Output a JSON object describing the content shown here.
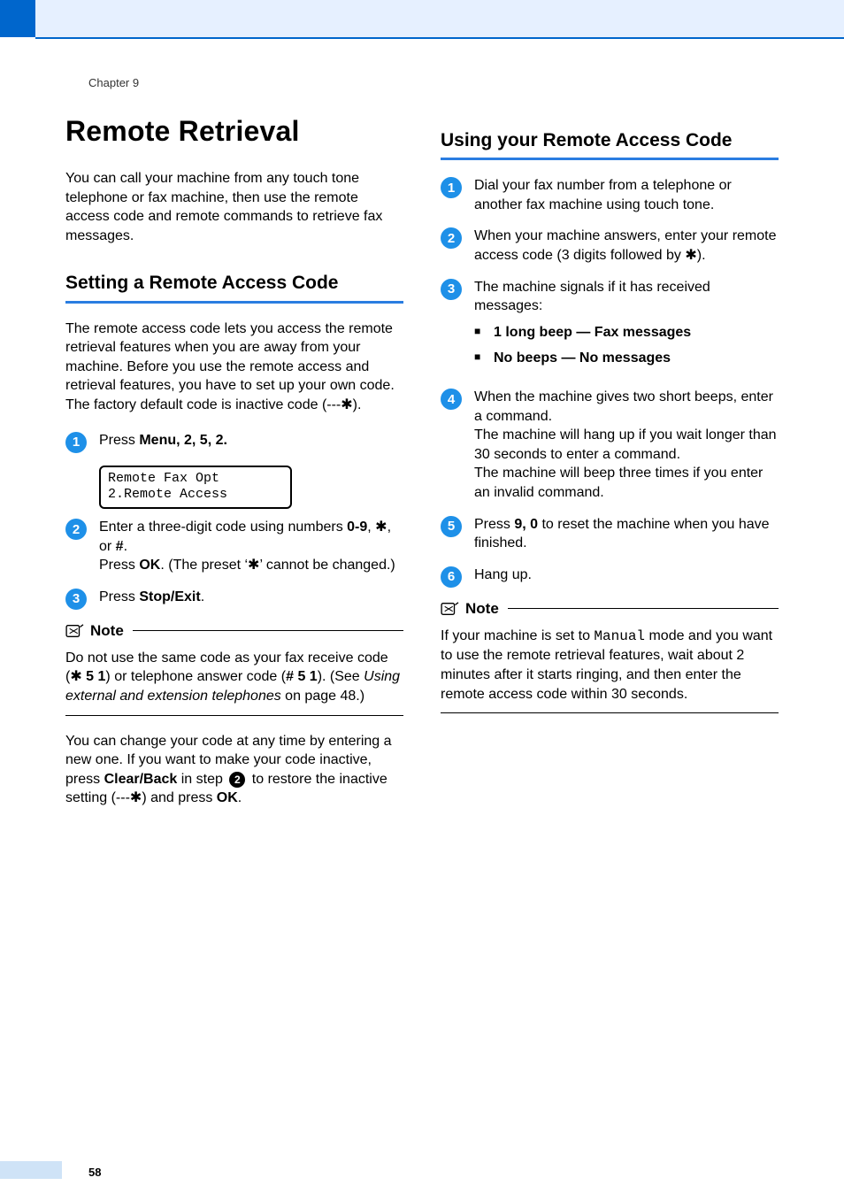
{
  "header": {
    "chapter": "Chapter 9"
  },
  "left": {
    "title": "Remote Retrieval",
    "intro": "You can call your machine from any touch tone telephone or fax machine, then use the remote access code and remote commands to retrieve fax messages.",
    "sec1_head": "Setting a Remote Access Code",
    "sec1_intro": "The remote access code lets you access the remote retrieval features when you are away from your machine. Before you use the remote access and retrieval features, you have to set up your own code. The factory default code is inactive code (---",
    "sec1_intro_tail": ").",
    "step1_pre": "Press ",
    "step1_menu": "Menu",
    "step1_keys": ", 2, 5, 2.",
    "lcd_line1": "Remote Fax Opt",
    "lcd_line2": "2.Remote Access",
    "step2a": "Enter a three-digit code using numbers ",
    "step2_keys": "0-9",
    "step2_sep1": ", ",
    "step2_sep2": ", or ",
    "step2_hash": "#",
    "step2_period": ".",
    "step2b": "Press ",
    "step2_ok": "OK",
    "step2c": ". (The preset ‘",
    "step2d": "’ cannot be changed.)",
    "step3_pre": "Press ",
    "step3_stop": "Stop/Exit",
    "step3_tail": ".",
    "note_label": "Note",
    "note1a": "Do not use the same code as your fax receive code (",
    "note1_code1": " 5 1",
    "note1b": ") or telephone answer code (",
    "note1_code2": "# 5 1",
    "note1c": "). (See ",
    "note1_italic": "Using external and extension telephones",
    "note1d": " on page 48.)",
    "closing_a": "You can change your code at any time by entering a new one. If you want to make your code inactive, press ",
    "closing_clear": "Clear/Back",
    "closing_b": " in step ",
    "closing_c": " to restore the inactive setting (---",
    "closing_d": ") and press ",
    "closing_ok": "OK",
    "closing_e": "."
  },
  "right": {
    "sec2_head": "Using your Remote Access Code",
    "r1": "Dial your fax number from a telephone or another fax machine using touch tone.",
    "r2a": "When your machine answers, enter your remote access code (3 digits followed by ",
    "r2b": ").",
    "r3": "The machine signals if it has received messages:",
    "r3_b1": "1 long beep — Fax messages",
    "r3_b2": "No beeps — No messages",
    "r4a": "When the machine gives two short beeps, enter a command.",
    "r4b": "The machine will hang up if you wait longer than 30 seconds to enter a command.",
    "r4c": "The machine will beep three times if you enter an invalid command.",
    "r5a": "Press ",
    "r5_keys": "9, 0",
    "r5b": " to reset the machine when you have finished.",
    "r6": "Hang up.",
    "note2a": "If your machine is set to ",
    "note2_mode": "Manual",
    "note2b": " mode and you want to use the remote retrieval features, wait about 2 minutes after it starts ringing, and then enter the remote access code within 30 seconds."
  },
  "footer": {
    "page": "58"
  }
}
